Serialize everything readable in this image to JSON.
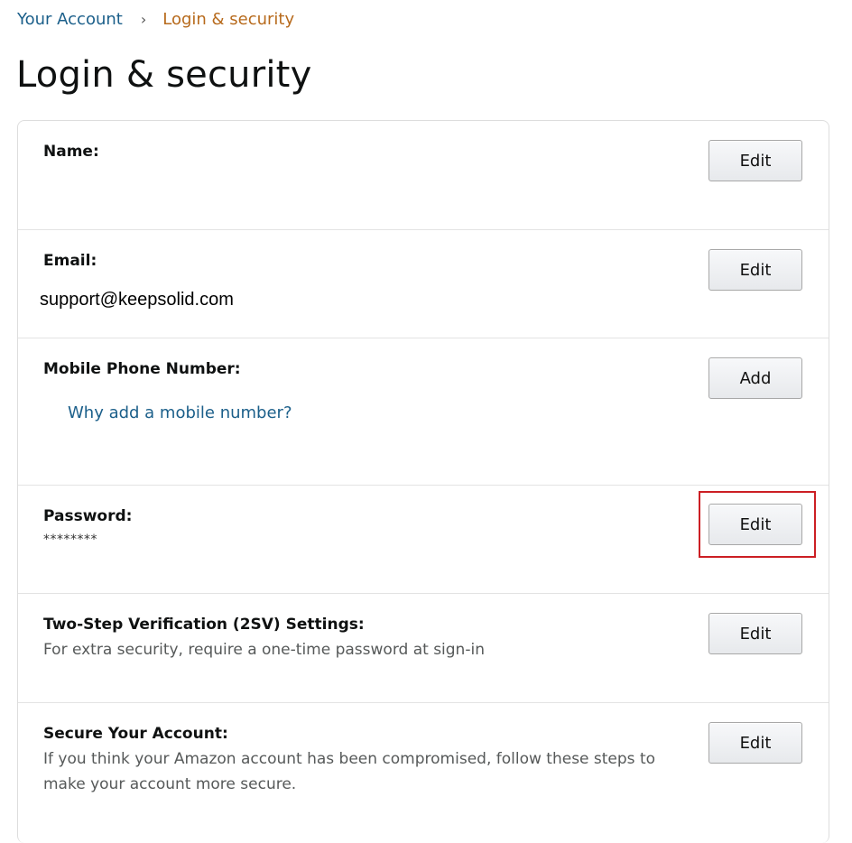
{
  "breadcrumb": {
    "parent": "Your Account",
    "separator": "›",
    "current": "Login & security"
  },
  "page_title": "Login & security",
  "colors": {
    "link": "#1b5f8a",
    "breadcrumb_current": "#b76a1c",
    "highlight": "#cc1f24"
  },
  "rows": {
    "name": {
      "label": "Name:",
      "value": "",
      "button": "Edit"
    },
    "email": {
      "label": "Email:",
      "value": "support@keepsolid.com",
      "button": "Edit"
    },
    "mobile": {
      "label": "Mobile Phone Number:",
      "link": "Why add a mobile number?",
      "button": "Add"
    },
    "password": {
      "label": "Password:",
      "value": "********",
      "button": "Edit",
      "highlighted": true
    },
    "two_step": {
      "label": "Two-Step Verification (2SV) Settings:",
      "description": "For extra security, require a one-time password at sign-in",
      "button": "Edit"
    },
    "secure": {
      "label": "Secure Your Account:",
      "description_line1": "If you think your Amazon account has been compromised, follow these steps to",
      "description_line2": "make your account more secure.",
      "button": "Edit"
    }
  }
}
